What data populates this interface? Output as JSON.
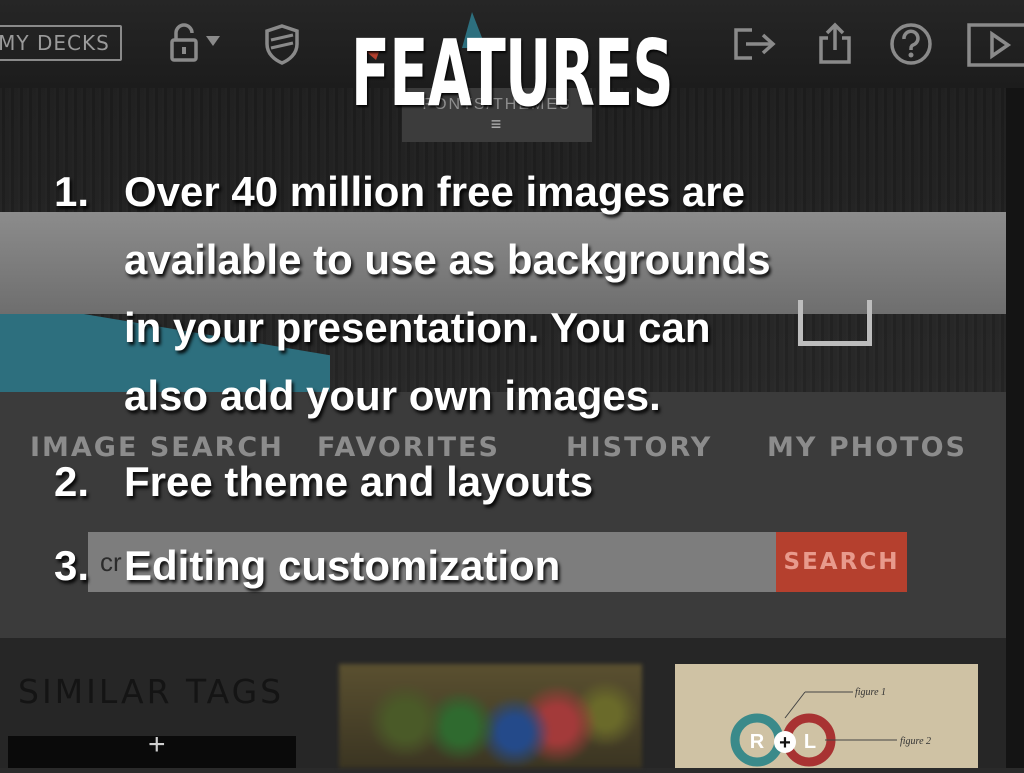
{
  "toolbar": {
    "my_decks_label": "MY DECKS",
    "icons": [
      "lock-icon",
      "shield-icon",
      "export-icon",
      "share-icon",
      "help-icon",
      "play-icon"
    ]
  },
  "editor": {
    "fonts_tab_label": "FONTS/THEMES"
  },
  "image_search": {
    "tabs": [
      "IMAGE SEARCH",
      "FAVORITES",
      "HISTORY",
      "MY PHOTOS"
    ],
    "query": "cr",
    "search_button": "SEARCH",
    "similar_tags_label": "SIMILAR TAGS",
    "thumbnail_labels": {
      "left_lobe": "R",
      "plus": "+",
      "right_lobe": "L",
      "figure1": "figure 1",
      "figure2": "figure 2"
    }
  },
  "slide": {
    "title": "FEATURES",
    "items": [
      {
        "number": "1.",
        "lines": [
          "Over 40 million free images are",
          "available to use as backgrounds",
          "in your presentation.  You can",
          "also add your own images."
        ]
      },
      {
        "number": "2.",
        "lines": [
          "Free theme and layouts"
        ]
      },
      {
        "number": "3.",
        "lines": [
          "Editing customization"
        ]
      }
    ]
  }
}
